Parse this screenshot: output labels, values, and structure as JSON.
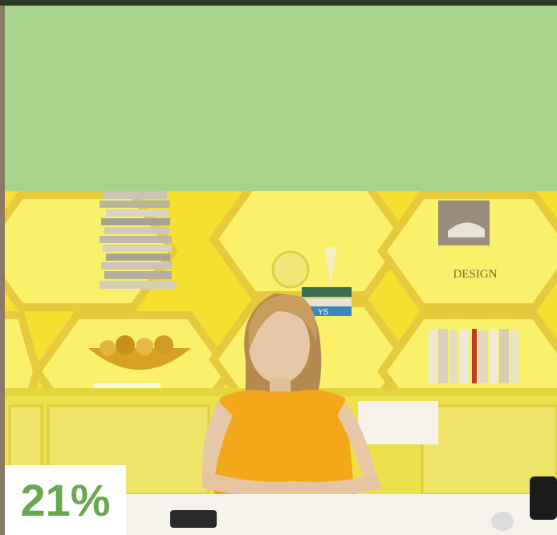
{
  "panel": {
    "color": "#a7d38c"
  },
  "photo": {
    "description_icon": "photo-woman-at-desk",
    "book_label": "DESIGN",
    "spine_label": "YS"
  },
  "stat": {
    "value": "21%",
    "color": "#6aa84f"
  }
}
